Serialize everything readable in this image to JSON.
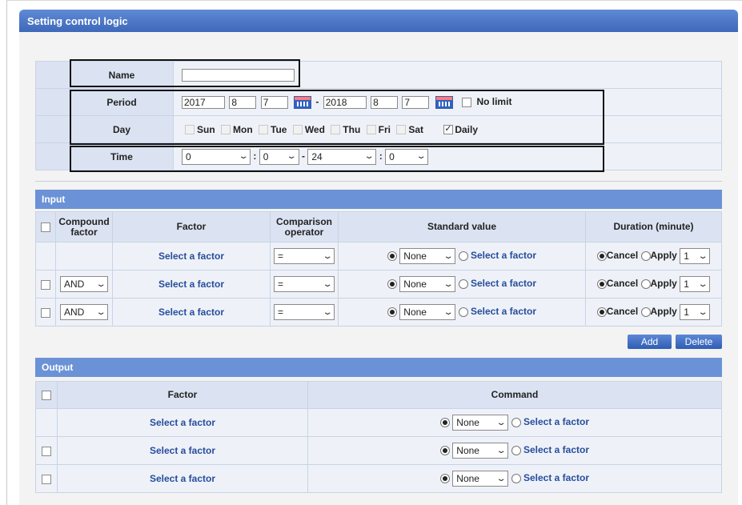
{
  "window": {
    "title": "Setting control logic"
  },
  "schedule": {
    "name_label": "Name",
    "name_value": "",
    "period_label": "Period",
    "start": {
      "year": "2017",
      "month": "8",
      "day": "7"
    },
    "range_sep": "-",
    "end": {
      "year": "2018",
      "month": "8",
      "day": "7"
    },
    "no_limit_label": "No limit",
    "day_label": "Day",
    "days": [
      "Sun",
      "Mon",
      "Tue",
      "Wed",
      "Thu",
      "Fri",
      "Sat"
    ],
    "daily_label": "Daily",
    "time_label": "Time",
    "time": {
      "start_hour": "0",
      "start_min": "0",
      "end_hour": "24",
      "end_min": "0",
      "colon": ":"
    }
  },
  "input": {
    "title": "Input",
    "headers": {
      "compound": "Compound factor",
      "factor": "Factor",
      "operator": "Comparison operator",
      "standard": "Standard value",
      "duration": "Duration (minute)"
    },
    "rows": [
      {
        "compound": "",
        "factor": "Select a factor",
        "operator": "=",
        "std_value": "None",
        "std_alt": "Select a factor",
        "cancel": "Cancel",
        "apply": "Apply",
        "duration": "1"
      },
      {
        "compound": "AND",
        "factor": "Select a factor",
        "operator": "=",
        "std_value": "None",
        "std_alt": "Select a factor",
        "cancel": "Cancel",
        "apply": "Apply",
        "duration": "1"
      },
      {
        "compound": "AND",
        "factor": "Select a factor",
        "operator": "=",
        "std_value": "None",
        "std_alt": "Select a factor",
        "cancel": "Cancel",
        "apply": "Apply",
        "duration": "1"
      }
    ],
    "add_label": "Add",
    "delete_label": "Delete"
  },
  "output": {
    "title": "Output",
    "headers": {
      "factor": "Factor",
      "command": "Command"
    },
    "rows": [
      {
        "factor": "Select a factor",
        "cmd_value": "None",
        "cmd_alt": "Select a factor"
      },
      {
        "factor": "Select a factor",
        "cmd_value": "None",
        "cmd_alt": "Select a factor"
      },
      {
        "factor": "Select a factor",
        "cmd_value": "None",
        "cmd_alt": "Select a factor"
      }
    ]
  },
  "colors": {
    "accent": "#3e68b9",
    "section_bar": "#6b92d6",
    "link": "#274d9c"
  }
}
